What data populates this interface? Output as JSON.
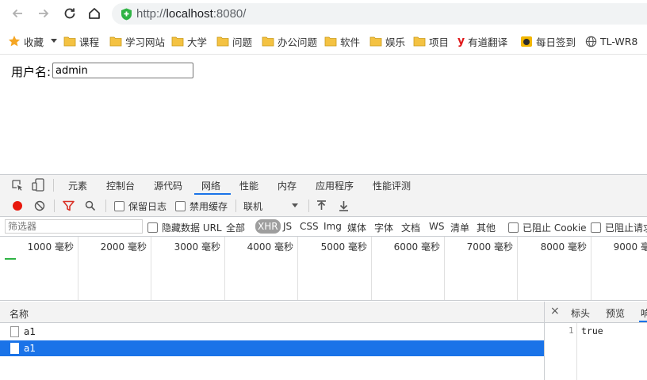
{
  "browser": {
    "url_scheme": "http://",
    "url_host": "localhost",
    "url_rest": ":8080/"
  },
  "bookmarks": {
    "star_label": "收藏",
    "items": [
      "课程",
      "学习网站",
      "大学",
      "问题",
      "办公问题",
      "软件",
      "娱乐",
      "项目"
    ],
    "youdao": "有道翻译",
    "daily": "每日签到",
    "tplink": "TL-WR8"
  },
  "page": {
    "username_label": "用户名:",
    "username_value": "admin"
  },
  "devtools": {
    "tabs": [
      "元素",
      "控制台",
      "源代码",
      "网络",
      "性能",
      "内存",
      "应用程序",
      "性能评测"
    ],
    "active_tab": "网络",
    "preserve_log": "保留日志",
    "disable_cache": "禁用缓存",
    "throttle": "联机",
    "filter_placeholder": "筛选器",
    "hide_data_urls": "隐藏数据 URL",
    "filter_types": [
      "全部",
      "XHR",
      "JS",
      "CSS",
      "Img",
      "媒体",
      "字体",
      "文档",
      "WS",
      "清单",
      "其他"
    ],
    "selected_filter": "XHR",
    "blocked_cookies": "已阻止 Cookie",
    "blocked_requests": "已阻止请求",
    "timeline_labels": [
      "1000 毫秒",
      "2000 毫秒",
      "3000 毫秒",
      "4000 毫秒",
      "5000 毫秒",
      "6000 毫秒",
      "7000 毫秒",
      "8000 毫秒",
      "9000 毫秒"
    ],
    "name_header": "名称",
    "requests": [
      {
        "name": "a1",
        "selected": false
      },
      {
        "name": "a1",
        "selected": true
      }
    ],
    "response_tabs": [
      "标头",
      "预览",
      "响应"
    ],
    "response_line": "1",
    "response_text": "true"
  },
  "colors": {
    "accent": "#1a73e8",
    "record_red": "#e8180c",
    "filter_red": "#d93025",
    "folder_yellow": "#f4c242",
    "secure_green": "#2fb344"
  }
}
